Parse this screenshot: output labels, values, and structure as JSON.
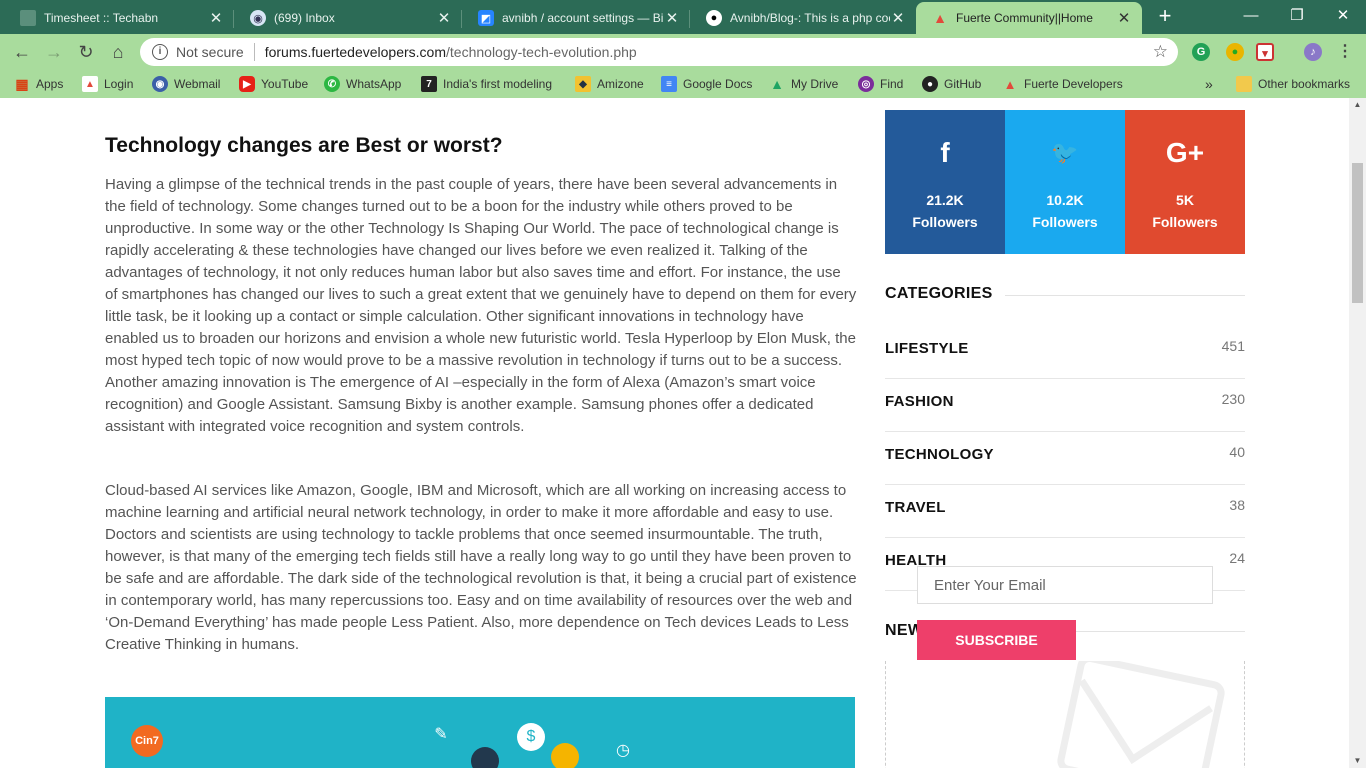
{
  "browser": {
    "tabs": [
      {
        "title": "Timesheet :: Techabn",
        "icon": "document-icon"
      },
      {
        "title": "(699) Inbox",
        "icon": "mail-icon"
      },
      {
        "title": "avnibh / account settings — Bi",
        "icon": "bitbucket-icon"
      },
      {
        "title": "Avnibh/Blog-: This is a php coo",
        "icon": "github-icon"
      },
      {
        "title": "Fuerte Community||Home",
        "icon": "fuerte-icon",
        "active": true
      }
    ],
    "new_tab": "+",
    "window_controls": {
      "minimize": "—",
      "restore": "❐",
      "close": "✕"
    },
    "address": {
      "security": "Not secure",
      "host": "forums.fuertedevelopers.com",
      "path": "/technology-tech-evolution.php"
    },
    "bookmarks": [
      {
        "label": "Apps",
        "icon": "apps-grid-icon"
      },
      {
        "label": "Login",
        "icon": "fuerte-icon"
      },
      {
        "label": "Webmail",
        "icon": "webmail-icon"
      },
      {
        "label": "YouTube",
        "icon": "youtube-icon"
      },
      {
        "label": "WhatsApp",
        "icon": "whatsapp-icon"
      },
      {
        "label": "India's first modeling",
        "icon": "seven-icon"
      },
      {
        "label": "Amizone",
        "icon": "amizone-icon"
      },
      {
        "label": "Google Docs",
        "icon": "google-docs-icon"
      },
      {
        "label": "My Drive",
        "icon": "drive-icon"
      },
      {
        "label": "Find",
        "icon": "find-icon"
      },
      {
        "label": "GitHub",
        "icon": "github-icon"
      },
      {
        "label": "Fuerte Developers",
        "icon": "fuerte-icon"
      }
    ],
    "overflow": "»",
    "other_bookmarks": "Other bookmarks"
  },
  "article": {
    "title": "Technology changes are Best or worst?",
    "paragraph1": "Having a glimpse of the technical trends in the past couple of years, there have been several advancements in the field of technology. Some changes turned out to be a boon for the industry while others proved to be unproductive. In some way or the other Technology Is Shaping Our World. The pace of technological change is rapidly accelerating & these technologies have changed our lives before we even realized it. Talking of the advantages of technology, it not only reduces human labor but also saves time and effort. For instance, the use of smartphones has changed our lives to such a great extent that we genuinely have to depend on them for every little task, be it looking up a contact or simple calculation. Other significant innovations in technology have enabled us to broaden our horizons and envision a whole new futuristic world. Tesla Hyperloop by Elon Musk, the most hyped tech topic of now would prove to be a massive revolution in technology if turns out to be a success. Another amazing innovation is The emergence of AI –especially in the form of Alexa (Amazon’s smart voice recognition) and Google Assistant. Samsung Bixby is another example. Samsung phones offer a dedicated assistant with integrated voice recognition and system controls.",
    "paragraph2": "Cloud-based AI services like Amazon, Google, IBM and Microsoft, which are all working on increasing access to machine learning and artificial neural network technology, in order to make it more affordable and easy to use. Doctors and scientists are using technology to tackle problems that once seemed insurmountable. The truth, however, is that many of the emerging tech fields still have a really long way to go until they have been proven to be safe and are affordable. The dark side of the technological revolution is that, it being a crucial part of existence in contemporary world, has many repercussions too. Easy and on time availability of resources over the web and ‘On-Demand Everything’ has made people Less Patient. Also, more dependence on Tech devices Leads to Less Creative Thinking in humans.",
    "banner_logo": "Cin7"
  },
  "sidebar": {
    "social": [
      {
        "icon": "facebook-icon",
        "glyph": "f",
        "count": "21.2K",
        "label": "Followers",
        "color": "#235a9a"
      },
      {
        "icon": "twitter-icon",
        "glyph": "🐦",
        "count": "10.2K",
        "label": "Followers",
        "color": "#1aa9ef"
      },
      {
        "icon": "google-plus-icon",
        "glyph": "G+",
        "count": "5K",
        "label": "Followers",
        "color": "#e04a2f"
      }
    ],
    "categories_heading": "CATEGORIES",
    "categories": [
      {
        "name": "LIFESTYLE",
        "count": "451"
      },
      {
        "name": "FASHION",
        "count": "230"
      },
      {
        "name": "TECHNOLOGY",
        "count": "40"
      },
      {
        "name": "TRAVEL",
        "count": "38"
      },
      {
        "name": "HEALTH",
        "count": "24"
      }
    ],
    "newsletter": {
      "heading": "NEWSLETTER",
      "email_placeholder": "Enter Your Email",
      "button": "SUBSCRIBE"
    }
  },
  "colors": {
    "chrome": "#2c6b56",
    "toolbar": "#a9dc9d",
    "subscribe": "#ee3f6a",
    "banner": "#1fb3c7"
  }
}
